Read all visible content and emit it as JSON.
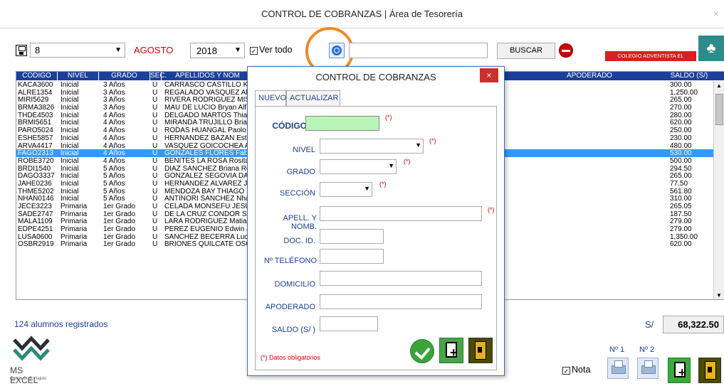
{
  "window": {
    "title": "CONTROL DE COBRANZAS | Área de Tesorería",
    "close": "×"
  },
  "toolbar": {
    "number": "8",
    "month": "AGOSTO",
    "year": "2018",
    "ver_todo": "Ver todo",
    "buscar": "BUSCAR",
    "search_value": "",
    "school_banner": "COLEGIO ADVENTISTA EL PORVENIR"
  },
  "grid": {
    "headers": {
      "codigo": "CÓDIGO",
      "nivel": "NIVEL",
      "grado": "GRADO",
      "sec": "SEC.",
      "apellidos": "APELLIDOS Y NOM",
      "apoderado": "APODERADO",
      "saldo": "SALDO (S/)"
    },
    "rows": [
      {
        "codigo": "KACA3600",
        "nivel": "Inicial",
        "grado": "3 Años",
        "sec": "U",
        "nombre": "CARRASCO CASTILLO KA",
        "saldo": "300.00"
      },
      {
        "codigo": "ALRE1354",
        "nivel": "Inicial",
        "grado": "3 Años",
        "sec": "U",
        "nombre": "REGALADO VASQUEZ Al",
        "saldo": "1,250.00"
      },
      {
        "codigo": "MIRI5629",
        "nivel": "Inicial",
        "grado": "3 Años",
        "sec": "U",
        "nombre": "RIVERA RODRIGUEZ MIS",
        "saldo": "265.00"
      },
      {
        "codigo": "BRMA3826",
        "nivel": "Inicial",
        "grado": "3 Años",
        "sec": "U",
        "nombre": "MAU DE LUCIO Bryan Alf",
        "saldo": "270.00"
      },
      {
        "codigo": "THDE4503",
        "nivel": "Inicial",
        "grado": "4 Años",
        "sec": "U",
        "nombre": "DELGADO MARTOS Thiac",
        "saldo": "280.00"
      },
      {
        "codigo": "BRMI5651",
        "nivel": "Inicial",
        "grado": "4 Años",
        "sec": "U",
        "nombre": "MIRANDA TRUJILLO Briar",
        "saldo": "620.00"
      },
      {
        "codigo": "PARO5024",
        "nivel": "Inicial",
        "grado": "4 Años",
        "sec": "U",
        "nombre": "RODAS HUANGAL Paolo",
        "saldo": "250.00"
      },
      {
        "codigo": "ESHE5857",
        "nivel": "Inicial",
        "grado": "4 Años",
        "sec": "U",
        "nombre": "HERNANDEZ BAZAN Esth",
        "saldo": "230.00"
      },
      {
        "codigo": "ARVA4417",
        "nivel": "Inicial",
        "grado": "4 Años",
        "sec": "U",
        "nombre": "VASQUEZ GOICOCHEA A",
        "saldo": "480.00"
      },
      {
        "codigo": "FAGO2313",
        "nivel": "Inicial",
        "grado": "4 Años",
        "sec": "U",
        "nombre": "GONZALES FLORES Fabr",
        "saldo": "530.00",
        "selected": true
      },
      {
        "codigo": "ROBE3720",
        "nivel": "Inicial",
        "grado": "4 Años",
        "sec": "U",
        "nombre": "BENITES LA ROSA Rosita",
        "saldo": "500.00"
      },
      {
        "codigo": "BRDI1540",
        "nivel": "Inicial",
        "grado": "5 Años",
        "sec": "U",
        "nombre": "DÍAZ SÁNCHEZ Briana Ro",
        "saldo": "294.50"
      },
      {
        "codigo": "DAGO3337",
        "nivel": "Inicial",
        "grado": "5 Años",
        "sec": "U",
        "nombre": "GONZALEZ SEGOVIA DA",
        "saldo": "265.00"
      },
      {
        "codigo": "JAHE0236",
        "nivel": "Inicial",
        "grado": "5 Años",
        "sec": "U",
        "nombre": "HERNÁNDEZ ALVAREZ J.",
        "saldo": "77.50"
      },
      {
        "codigo": "THME5202",
        "nivel": "Inicial",
        "grado": "5 Años",
        "sec": "U",
        "nombre": "MENDOZA BAY THIAGO",
        "saldo": "561.80"
      },
      {
        "codigo": "NHAN0146",
        "nivel": "Inicial",
        "grado": "5 Años",
        "sec": "U",
        "nombre": "ANTINORI SANCHEZ Nha",
        "saldo": "310.00"
      },
      {
        "codigo": "JECE3223",
        "nivel": "Primaria",
        "grado": "1er Grado",
        "sec": "U",
        "nombre": "CELADA MONSEFÚ JESÚ",
        "saldo": "265.05"
      },
      {
        "codigo": "SADE2747",
        "nivel": "Primaria",
        "grado": "1er Grado",
        "sec": "U",
        "nombre": "DE LA CRUZ CONDOR Sa",
        "saldo": "187.50"
      },
      {
        "codigo": "MALA1109",
        "nivel": "Primaria",
        "grado": "1er Grado",
        "sec": "U",
        "nombre": "LARA RODRIGUEZ Matias",
        "saldo": "279.00"
      },
      {
        "codigo": "EDPE4251",
        "nivel": "Primaria",
        "grado": "1er Grado",
        "sec": "U",
        "nombre": "PEREZ EUGENIO Edwin J",
        "saldo": "279.00"
      },
      {
        "codigo": "LUSA0600",
        "nivel": "Primaria",
        "grado": "1er Grado",
        "sec": "U",
        "nombre": "SANCHEZ BECERRA Luca",
        "saldo": "1,350.00"
      },
      {
        "codigo": "OSBR2919",
        "nivel": "Primaria",
        "grado": "1er Grado",
        "sec": "U",
        "nombre": "BRIONES QUILCATE OSC",
        "saldo": "620.00"
      }
    ]
  },
  "footer": {
    "count": "124 alumnos registrados",
    "currency": "S/",
    "total": "68,322.50",
    "nota": "Nota",
    "n1": "Nº 1",
    "n2": "Nº 2",
    "logo_text": "MS EXCEL",
    "logo_sub": "Carlos C. S. Hajido"
  },
  "dialog": {
    "title": "CONTROL DE COBRANZAS",
    "close": "×",
    "tab_nuevo": "NUEVO",
    "tab_actualizar": "ACTUALIZAR",
    "lbl_codigo": "CÓDIGO",
    "lbl_nivel": "NIVEL",
    "lbl_grado": "GRADO",
    "lbl_seccion": "SECCIÓN",
    "lbl_apell": "APELL. Y NOMB.",
    "lbl_doc": "DOC. ID.",
    "lbl_tel": "Nº TELÉFONO",
    "lbl_dom": "DOMICILIO",
    "lbl_apod": "APODERADO",
    "lbl_saldo": "SALDO (S/ )",
    "req": "(*)",
    "oblig": "(*) Datos obligatorios"
  }
}
